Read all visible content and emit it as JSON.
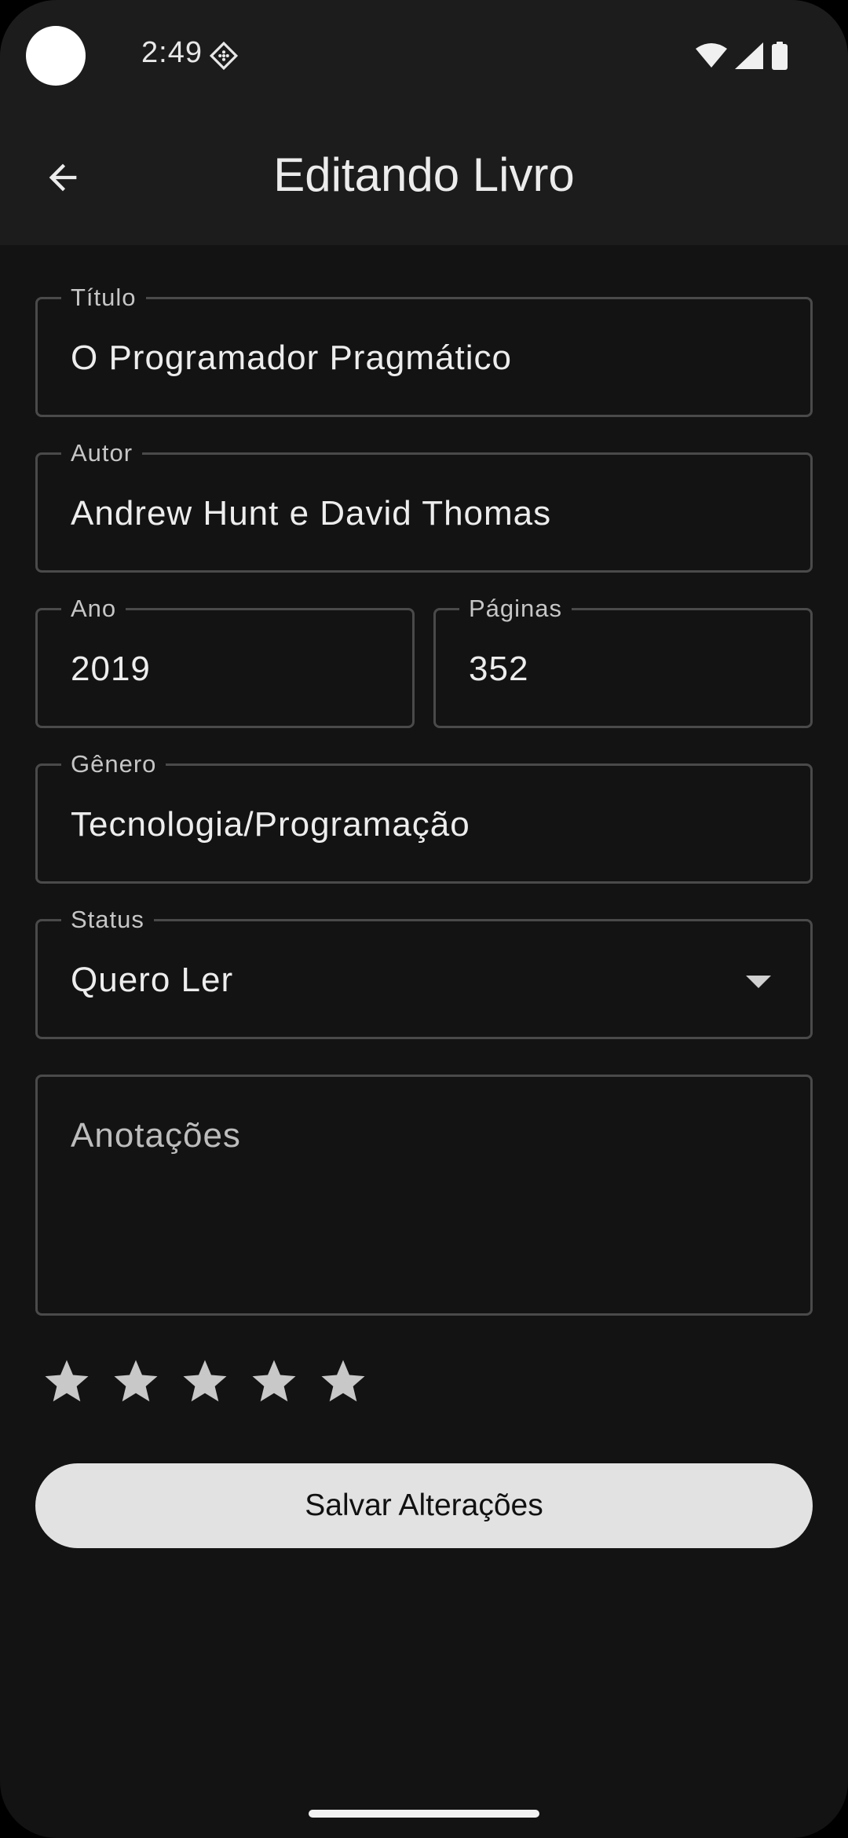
{
  "status_bar": {
    "time": "2:49"
  },
  "app_bar": {
    "title": "Editando Livro"
  },
  "form": {
    "title": {
      "label": "Título",
      "value": "O Programador Pragmático"
    },
    "author": {
      "label": "Autor",
      "value": "Andrew Hunt e David Thomas"
    },
    "year": {
      "label": "Ano",
      "value": "2019"
    },
    "pages": {
      "label": "Páginas",
      "value": "352"
    },
    "genre": {
      "label": "Gênero",
      "value": "Tecnologia/Programação"
    },
    "status": {
      "label": "Status",
      "value": "Quero Ler"
    },
    "notes": {
      "placeholder": "Anotações"
    },
    "rating": {
      "value": 0,
      "max": 5
    }
  },
  "save_button": {
    "label": "Salvar Alterações"
  },
  "colors": {
    "background": "#131313",
    "app_bar": "#1c1c1c",
    "outline": "#4a4a4a",
    "button": "#e2e2e2",
    "star_inactive": "#c8c8c8"
  }
}
